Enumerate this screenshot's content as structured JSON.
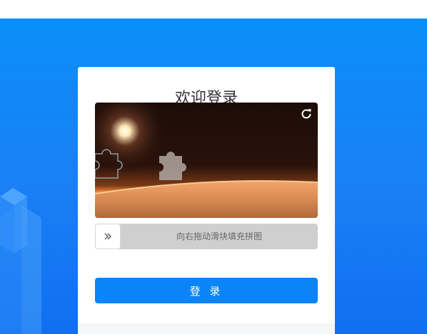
{
  "login": {
    "title": "欢迎登录",
    "slider_hint": "向右拖动滑块填充拼图",
    "submit_label": "登 录"
  },
  "icons": {
    "refresh": "refresh-icon",
    "slider_handle": "double-chevron-right-icon"
  },
  "colors": {
    "page_background": "#0a8ff8",
    "button": "#0a84f6",
    "slider_track": "#cfcfcf"
  }
}
